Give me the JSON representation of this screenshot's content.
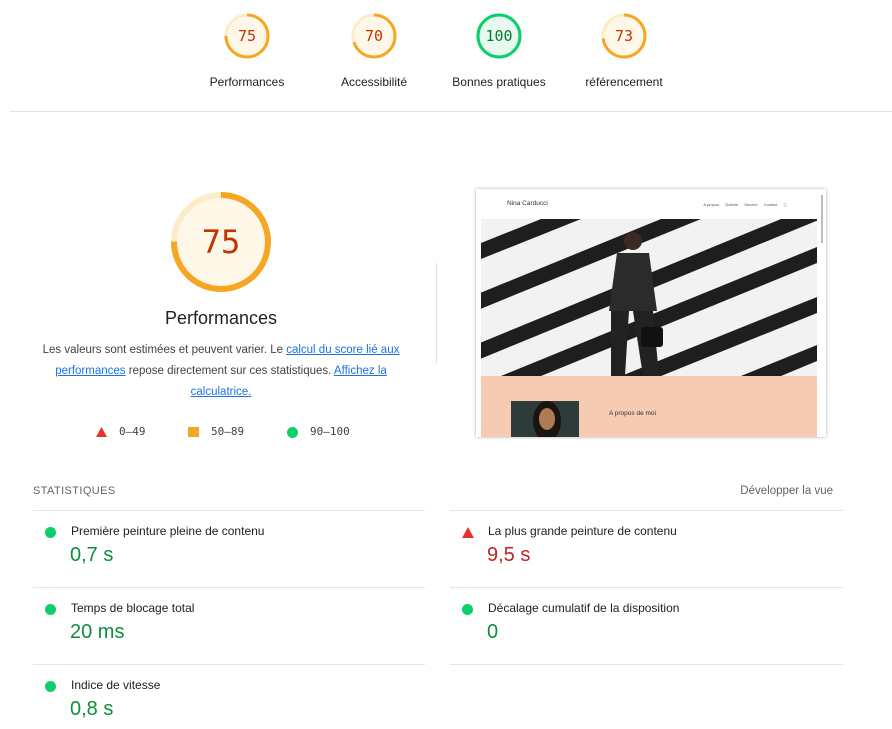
{
  "categories": [
    {
      "score": "75",
      "label": "Performances",
      "value": 0.75,
      "color": "#f5a623"
    },
    {
      "score": "70",
      "label": "Accessibilité",
      "value": 0.7,
      "color": "#f5a623"
    },
    {
      "score": "100",
      "label": "Bonnes pratiques",
      "value": 1.0,
      "color": "#0cce6b"
    },
    {
      "score": "73",
      "label": "référencement",
      "value": 0.73,
      "color": "#f5a623"
    }
  ],
  "performance": {
    "score": "75",
    "value": 0.75,
    "title": "Performances",
    "desc_1": "Les valeurs sont estimées et peuvent varier. Le ",
    "link_1": "calcul du score lié aux performances",
    "desc_2": " repose directement sur ces statistiques. ",
    "link_2": "Affichez la calculatrice.",
    "legend": [
      {
        "symbol": "triangle-icon",
        "range": "0–49",
        "color": "#e8312a"
      },
      {
        "symbol": "square-icon",
        "range": "50–89",
        "color": "#f5a623"
      },
      {
        "symbol": "circle-icon",
        "range": "90–100",
        "color": "#0cce6b"
      }
    ]
  },
  "screenshot": {
    "site_name": "Nina Carducci",
    "nav": [
      "A propos",
      "Galerie",
      "Service",
      "Contact"
    ],
    "about_title": "A propos de moi"
  },
  "stats": {
    "heading": "STATISTIQUES",
    "expand_label": "Développer la vue",
    "metrics": [
      {
        "label": "Première peinture pleine de contenu",
        "value": "0,7 s",
        "status": "good"
      },
      {
        "label": "La plus grande peinture de contenu",
        "value": "9,5 s",
        "status": "poor"
      },
      {
        "label": "Temps de blocage total",
        "value": "20 ms",
        "status": "good"
      },
      {
        "label": "Décalage cumulatif de la disposition",
        "value": "0",
        "status": "good"
      },
      {
        "label": "Indice de vitesse",
        "value": "0,8 s",
        "status": "good"
      }
    ]
  }
}
